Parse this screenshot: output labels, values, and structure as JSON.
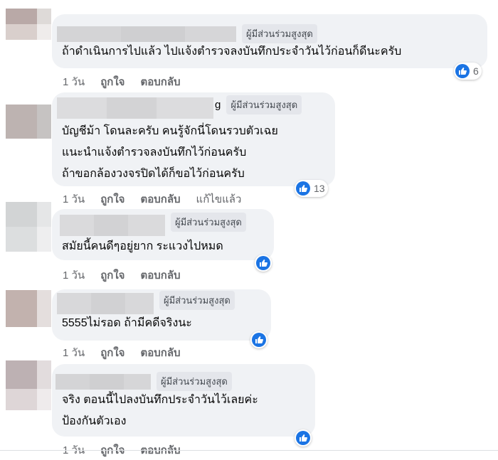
{
  "top_fan_badge": "ผู้มีส่วนร่วมสูงสุด",
  "comments": [
    {
      "lines": [
        "ถ้าดำเนินการไปแล้ว ไปแจ้งตำรวจลงบันทึกประจำวันไว้ก่อนก็ดีนะครับ"
      ],
      "time": "1 วัน",
      "like": "ถูกใจ",
      "reply": "ตอบกลับ",
      "edited": "",
      "reactions": "6"
    },
    {
      "name_suffix": "g",
      "lines": [
        "บัญชีม้า โดนละครับ คนรู้จักนี่โดนรวบตัวเฉย",
        "แนะนำแจ้งตำรวจลงบันทึกไว้ก่อนครับ",
        "ถ้าขอกล้องวงจรปิดได้ก็ขอไว้ก่อนครับ"
      ],
      "time": "1 วัน",
      "like": "ถูกใจ",
      "reply": "ตอบกลับ",
      "edited": "แก้ไขแล้ว",
      "reactions": "13"
    },
    {
      "lines": [
        "สมัยนี้คนดีๆอยู่ยาก ระแวงไปหมด"
      ],
      "time": "1 วัน",
      "like": "ถูกใจ",
      "reply": "ตอบกลับ",
      "edited": "",
      "reactions": ""
    },
    {
      "lines": [
        "5555ไม่รอด ถ้ามีคดีจริงนะ"
      ],
      "time": "1 วัน",
      "like": "ถูกใจ",
      "reply": "ตอบกลับ",
      "edited": "",
      "reactions": ""
    },
    {
      "lines": [
        "จริง ตอนนี้ไปลงบันทึกประจำวันไว้เลยค่ะ",
        "ป้องกันตัวเอง"
      ],
      "time": "1 วัน",
      "like": "ถูกใจ",
      "reply": "ตอบกลับ",
      "edited": "",
      "reactions": ""
    }
  ],
  "colors": {
    "bubble": "#f0f2f5",
    "badge_bg": "#e4e6eb",
    "like_blue": "#1b74e4",
    "meta_gray": "#65676b"
  },
  "icons": {
    "reaction": "like-thumb-icon"
  }
}
